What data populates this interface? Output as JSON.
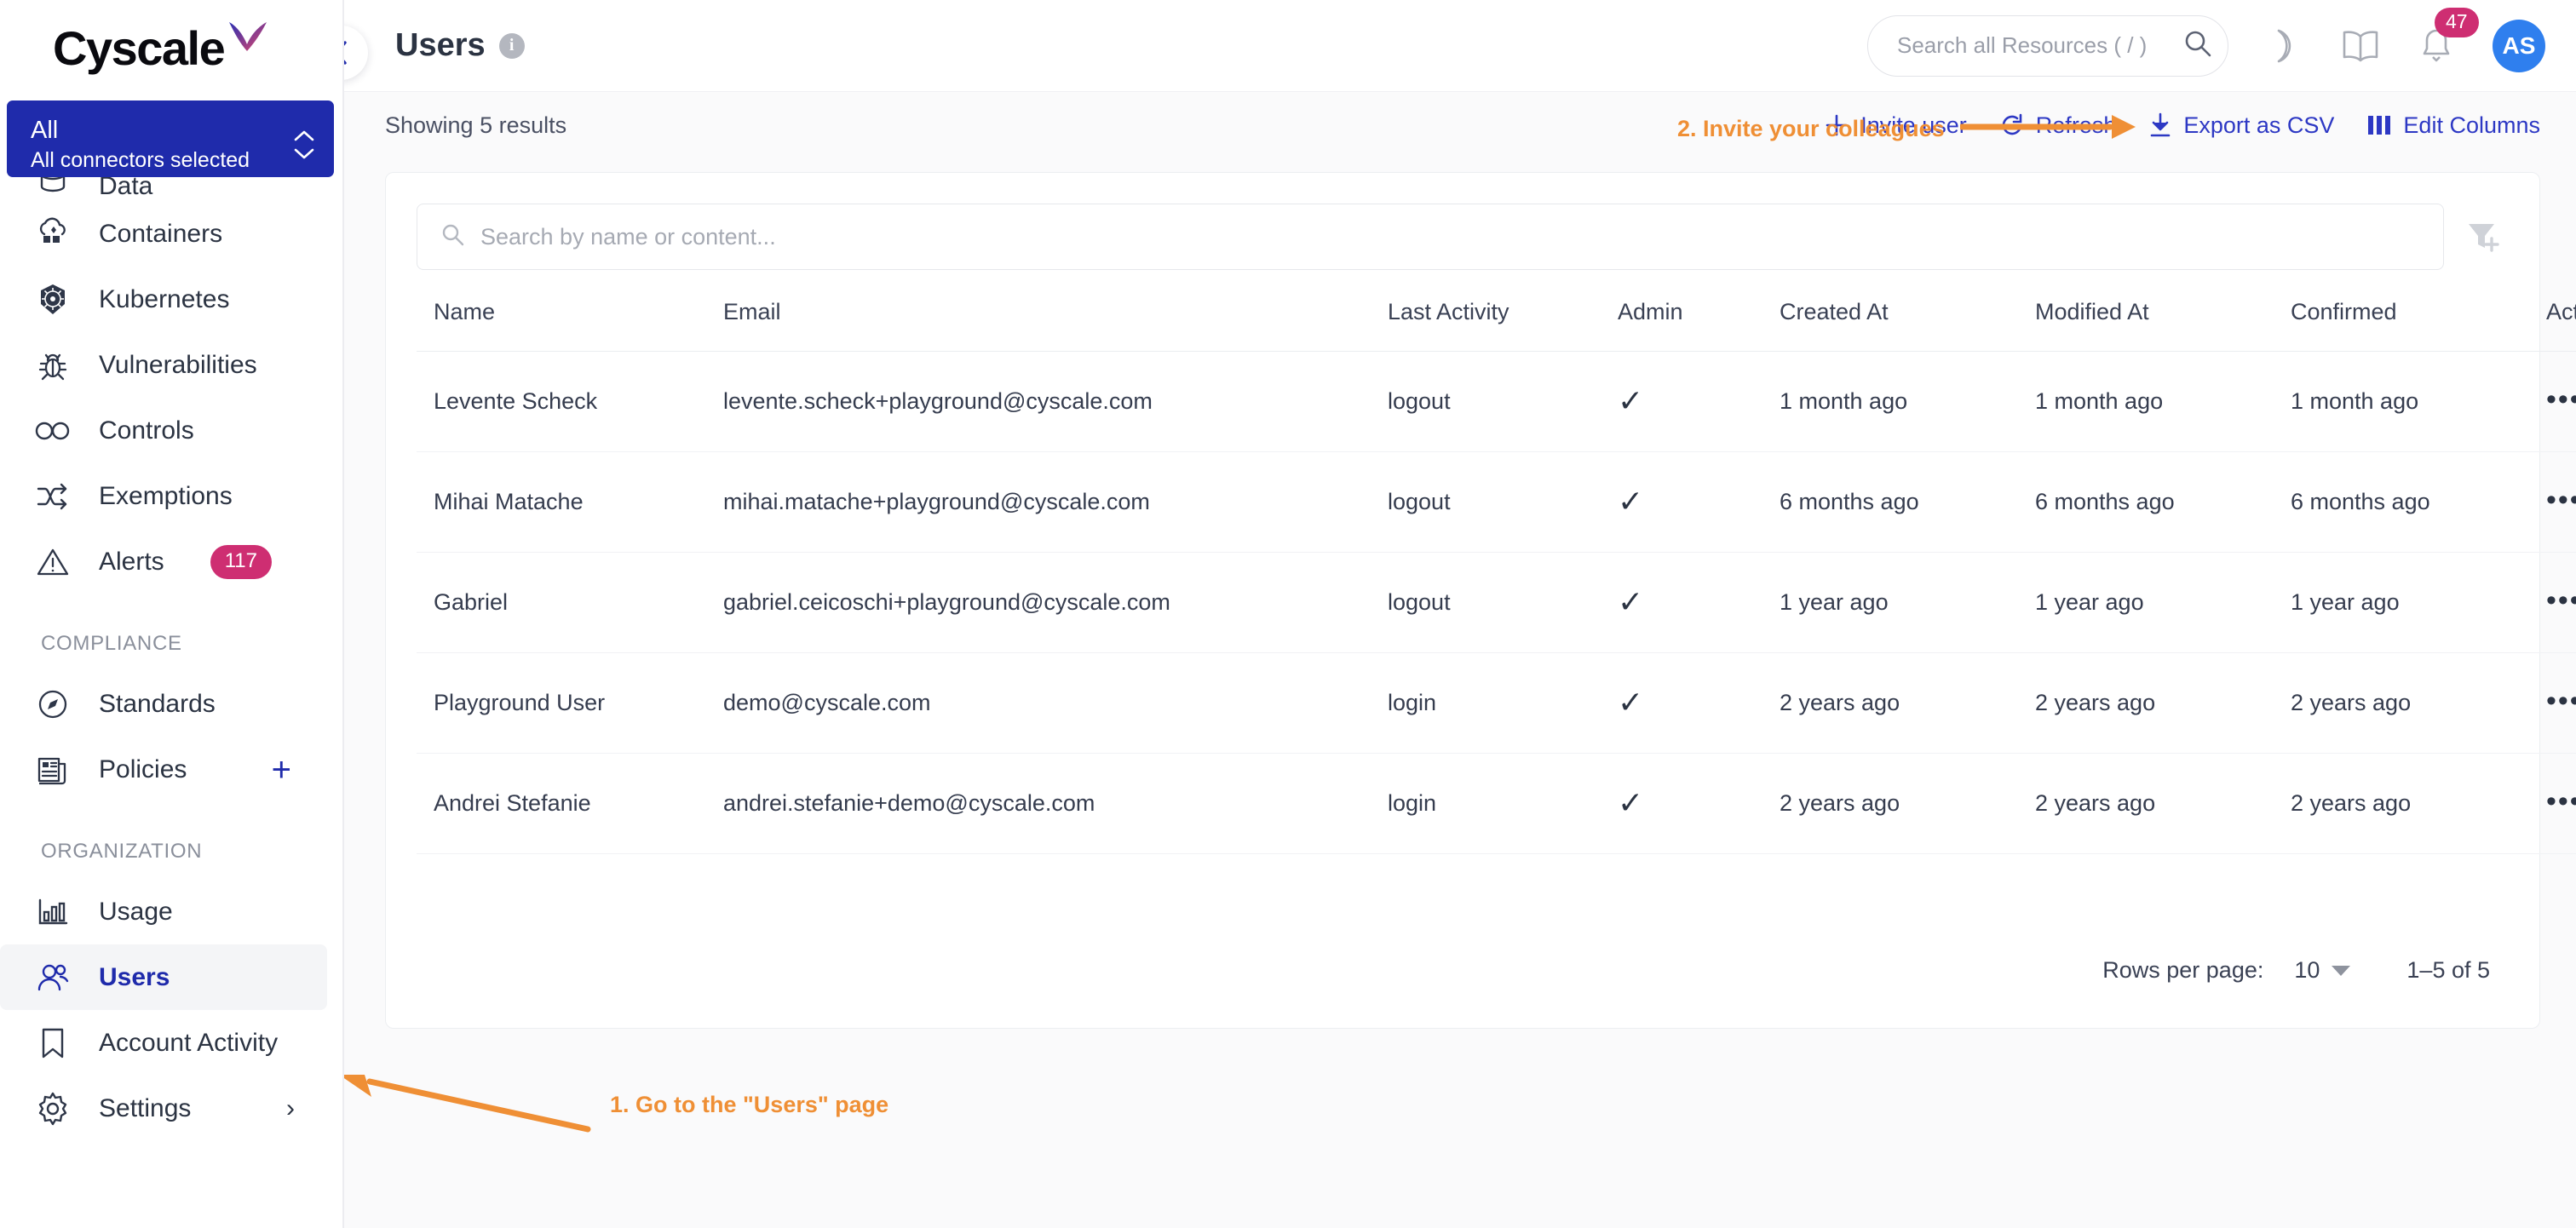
{
  "brand": {
    "name": "Cyscale",
    "accent": "#1f2bab",
    "orange": "#ef8f35",
    "pink": "#ce2e72",
    "avatar_blue": "#2f7fee"
  },
  "sidebar": {
    "connector": {
      "title": "All",
      "subtitle": "All connectors selected"
    },
    "items": [
      {
        "label": "Data",
        "icon": "database-icon",
        "clipped": true
      },
      {
        "label": "Containers",
        "icon": "containers-cloud-icon"
      },
      {
        "label": "Kubernetes",
        "icon": "kubernetes-icon"
      },
      {
        "label": "Vulnerabilities",
        "icon": "bug-icon"
      },
      {
        "label": "Controls",
        "icon": "infinity-icon"
      },
      {
        "label": "Exemptions",
        "icon": "shuffle-icon"
      },
      {
        "label": "Alerts",
        "icon": "alert-triangle-icon",
        "badge": "117"
      }
    ],
    "compliance_label": "COMPLIANCE",
    "compliance_items": [
      {
        "label": "Standards",
        "icon": "compass-icon"
      },
      {
        "label": "Policies",
        "icon": "news-icon",
        "plus": "+"
      }
    ],
    "organization_label": "ORGANIZATION",
    "organization_items": [
      {
        "label": "Usage",
        "icon": "bar-chart-icon"
      },
      {
        "label": "Users",
        "icon": "users-icon",
        "active": true
      },
      {
        "label": "Account Activity",
        "icon": "bookmark-icon"
      },
      {
        "label": "Settings",
        "icon": "gear-icon",
        "chevron": "›"
      }
    ]
  },
  "topbar": {
    "collapse_icon": "chevron-left-icon",
    "title": "Users",
    "info_char": "i",
    "search_placeholder": "Search all Resources ( / )",
    "search_value": "",
    "dark_mode_icon": "moon-icon",
    "docs_icon": "book-icon",
    "notifications_icon": "bell-icon",
    "notifications_count": "47",
    "avatar_initials": "AS"
  },
  "toolbar": {
    "showing": "Showing 5 results",
    "annotation_2": "2. Invite your colleagues",
    "invite_user": "Invite user",
    "refresh": "Refresh",
    "export_csv": "Export as CSV",
    "edit_columns": "Edit Columns"
  },
  "table": {
    "search_placeholder": "Search by name or content...",
    "search_value": "",
    "columns": [
      "Name",
      "Email",
      "Last Activity",
      "Admin",
      "Created At",
      "Modified At",
      "Confirmed",
      "Actions"
    ],
    "rows": [
      {
        "name": "Levente Scheck",
        "email": "levente.scheck+playground@cyscale.com",
        "last_activity": "logout",
        "admin": "✓",
        "created_at": "1 month ago",
        "modified_at": "1 month ago",
        "confirmed": "1 month ago",
        "actions": "•••"
      },
      {
        "name": "Mihai Matache",
        "email": "mihai.matache+playground@cyscale.com",
        "last_activity": "logout",
        "admin": "✓",
        "created_at": "6 months ago",
        "modified_at": "6 months ago",
        "confirmed": "6 months ago",
        "actions": "•••"
      },
      {
        "name": "Gabriel",
        "email": "gabriel.ceicoschi+playground@cyscale.com",
        "last_activity": "logout",
        "admin": "✓",
        "created_at": "1 year ago",
        "modified_at": "1 year ago",
        "confirmed": "1 year ago",
        "actions": "•••"
      },
      {
        "name": "Playground User",
        "email": "demo@cyscale.com",
        "last_activity": "login",
        "admin": "✓",
        "created_at": "2 years ago",
        "modified_at": "2 years ago",
        "confirmed": "2 years ago",
        "actions": "•••"
      },
      {
        "name": "Andrei Stefanie",
        "email": "andrei.stefanie+demo@cyscale.com",
        "last_activity": "login",
        "admin": "✓",
        "created_at": "2 years ago",
        "modified_at": "2 years ago",
        "confirmed": "2 years ago",
        "actions": "•••"
      }
    ]
  },
  "pagination": {
    "rows_per_page_label": "Rows per page:",
    "rows_per_page_value": "10",
    "range": "1–5 of 5"
  },
  "annotations": {
    "step1": "1. Go to the \"Users\" page"
  }
}
